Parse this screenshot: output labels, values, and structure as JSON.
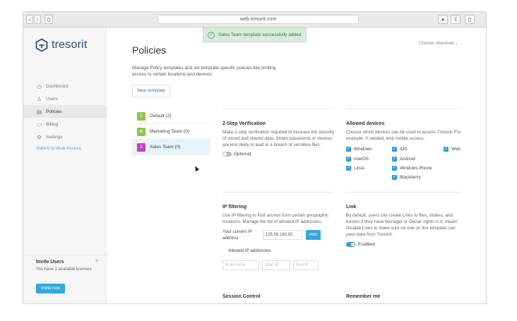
{
  "browser": {
    "url": "web.tresorit.com",
    "nav_back": "‹",
    "nav_forward": "›",
    "sidebar_btn": "▯",
    "tabs_btn": "▯",
    "share_btn": "⇧",
    "info_btn": "●"
  },
  "toast": {
    "text": "Sales Team template successfully added"
  },
  "user": {
    "name": "Chester Marshall"
  },
  "sidebar": {
    "brand": "tresorit",
    "items": [
      {
        "label": "Dashboard",
        "icon": "dashboard-icon",
        "glyph": "◷"
      },
      {
        "label": "Users",
        "icon": "users-icon",
        "glyph": "♙"
      },
      {
        "label": "Policies",
        "icon": "policies-icon",
        "glyph": "▤"
      },
      {
        "label": "Billing",
        "icon": "billing-icon",
        "glyph": "▭"
      },
      {
        "label": "Settings",
        "icon": "settings-icon",
        "glyph": "⚙"
      }
    ],
    "switch_link": "Switch to Web Access",
    "invite": {
      "title": "Invite Users",
      "text": "You have 2 available licenses",
      "button": "Invite now",
      "close": "✕"
    }
  },
  "main": {
    "title": "Policies",
    "description": "Manage Policy templates and set template-specific policies like limiting access to certain locations and devices.",
    "new_template": "New template",
    "templates": [
      {
        "letter": "D",
        "label": "Default (2)",
        "color": "#8bc34a"
      },
      {
        "letter": "M",
        "label": "Marketing Team (0)",
        "color": "#8bc34a"
      },
      {
        "letter": "S",
        "label": "Sales Team (0)",
        "color": "#c13fc4"
      }
    ]
  },
  "two_step": {
    "title": "2-Step Verification",
    "text": "Make 2-step verification required to increase the security of stored and shared data. Stolen passwords or devices are less likely to lead to a breach of sensitive files.",
    "toggle_label": "Optional"
  },
  "devices": {
    "title": "Allowed devices",
    "text": "Choose which devices can be used to access Tresorit. For example, if needed, limit mobile access.",
    "options": [
      "Windows",
      "macOS",
      "Linux",
      "iOS",
      "Android",
      "Windows Phone",
      "Blackberry",
      "Web"
    ]
  },
  "ip": {
    "title": "IP filtering",
    "text": "Use IP filtering to limit access from certain geographic locations. Manage the list of allowed IP addresses.",
    "current_label": "Your current IP address",
    "current_ip": "135.56.180.82",
    "add": "Add",
    "allowed_label": "Allowed IP addresses",
    "rule_name_ph": "Rule name",
    "start_ip_ph": "Start IP",
    "end_ip_ph": "End IP"
  },
  "link": {
    "title": "Link",
    "text": "By default, users can create Links to files, folders, and tresors if they have Manager or Owner rights in it, meant. Disable Links to make sure no one on this template can pass data from Tresorit.",
    "toggle_label": "Enabled"
  },
  "session": {
    "title": "Session Control"
  },
  "remember": {
    "title": "Remember me"
  }
}
